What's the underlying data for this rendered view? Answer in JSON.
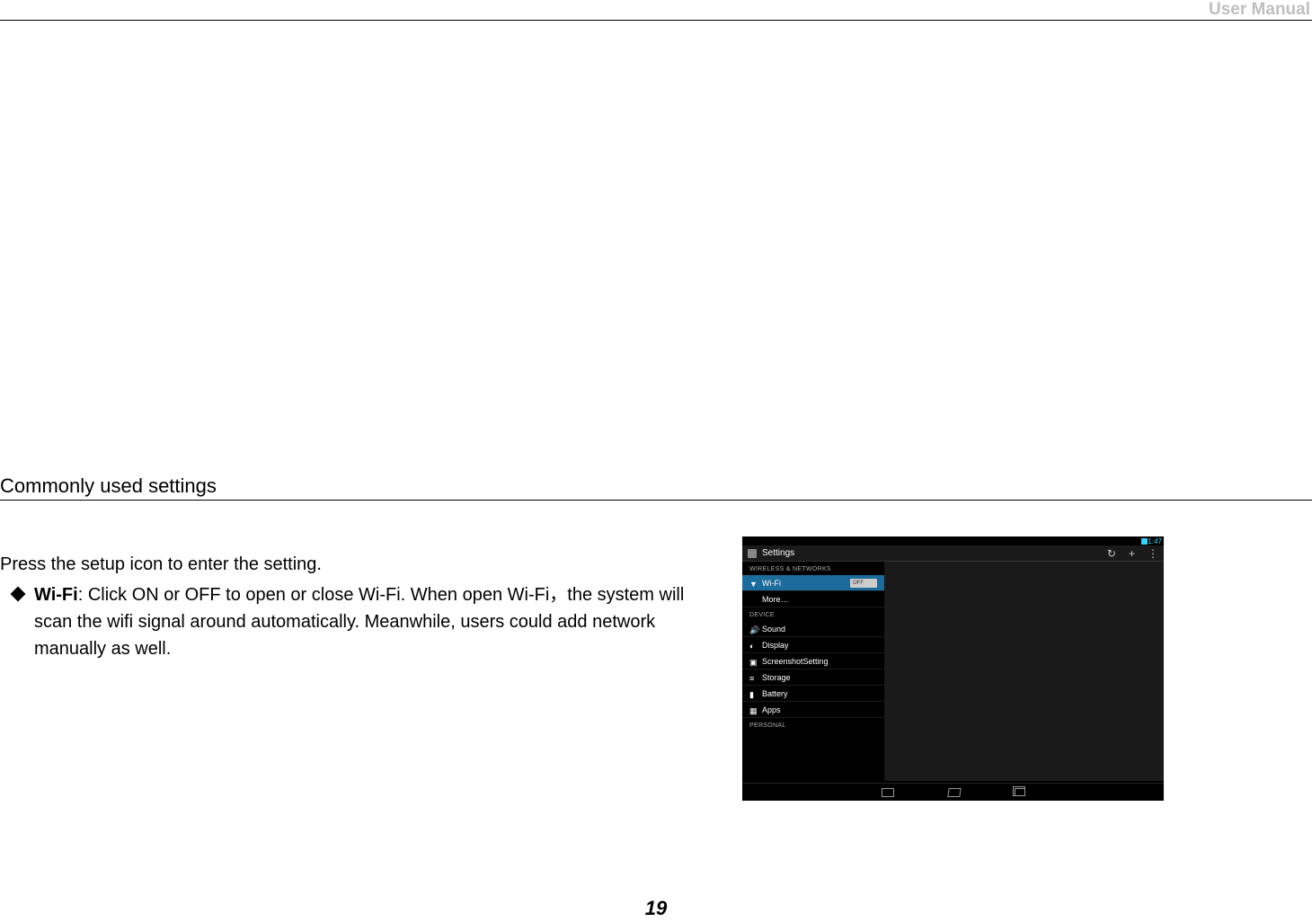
{
  "header": {
    "title": "User Manual"
  },
  "section": {
    "heading": "Commonly used settings"
  },
  "intro": "Press the setup icon to enter the setting.",
  "bullet": {
    "label": "Wi-Fi",
    "text": ": Click ON or OFF to open or close Wi-Fi. When open Wi-Fi，the system will scan the wifi signal around automatically. Meanwhile, users could add network manually as well."
  },
  "page_number": "19",
  "screenshot": {
    "status_time": "1:47",
    "app_title": "Settings",
    "header_icons": [
      "refresh",
      "add",
      "menu"
    ],
    "categories": [
      {
        "name": "WIRELESS & NETWORKS",
        "items": [
          {
            "icon": "wifi-icon",
            "label": "Wi-Fi",
            "selected": true,
            "switch": "OFF"
          },
          {
            "icon": "",
            "label": "More…",
            "selected": false
          }
        ]
      },
      {
        "name": "DEVICE",
        "items": [
          {
            "icon": "sound-icon",
            "label": "Sound"
          },
          {
            "icon": "display-icon",
            "label": "Display"
          },
          {
            "icon": "screenshot-icon",
            "label": "ScreenshotSetting"
          },
          {
            "icon": "storage-icon",
            "label": "Storage"
          },
          {
            "icon": "battery-icon",
            "label": "Battery"
          },
          {
            "icon": "apps-icon",
            "label": "Apps"
          }
        ]
      },
      {
        "name": "PERSONAL",
        "items": []
      }
    ],
    "nav": [
      "back",
      "home",
      "recent"
    ]
  }
}
